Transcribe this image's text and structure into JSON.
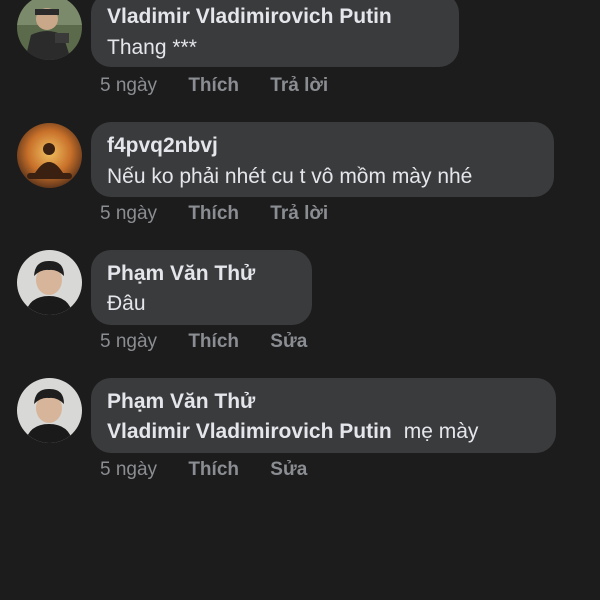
{
  "comments": [
    {
      "author": "Vladimir Vladimirovich Putin",
      "text": "Thang ***",
      "time": "5 ngày",
      "actions": [
        "Thích",
        "Trả lời"
      ],
      "avatar": "avatar-putin"
    },
    {
      "author": "f4pvq2nbvj",
      "text": "Nếu ko phải nhét cu t vô mồm mày nhé",
      "time": "5 ngày",
      "actions": [
        "Thích",
        "Trả lời"
      ],
      "avatar": "avatar-meditation"
    },
    {
      "author": "Phạm Văn Thử",
      "text": "Đâu",
      "time": "5 ngày",
      "actions": [
        "Thích",
        "Sửa"
      ],
      "avatar": "avatar-young-man"
    },
    {
      "author": "Phạm Văn Thử",
      "mention": "Vladimir Vladimirovich Putin",
      "text": "mẹ mày",
      "time": "5 ngày",
      "actions": [
        "Thích",
        "Sửa"
      ],
      "avatar": "avatar-young-man"
    }
  ],
  "colors": {
    "background": "#1c1c1d",
    "bubble": "#3a3b3c",
    "text": "#e4e6eb",
    "meta": "#8a8d91"
  }
}
